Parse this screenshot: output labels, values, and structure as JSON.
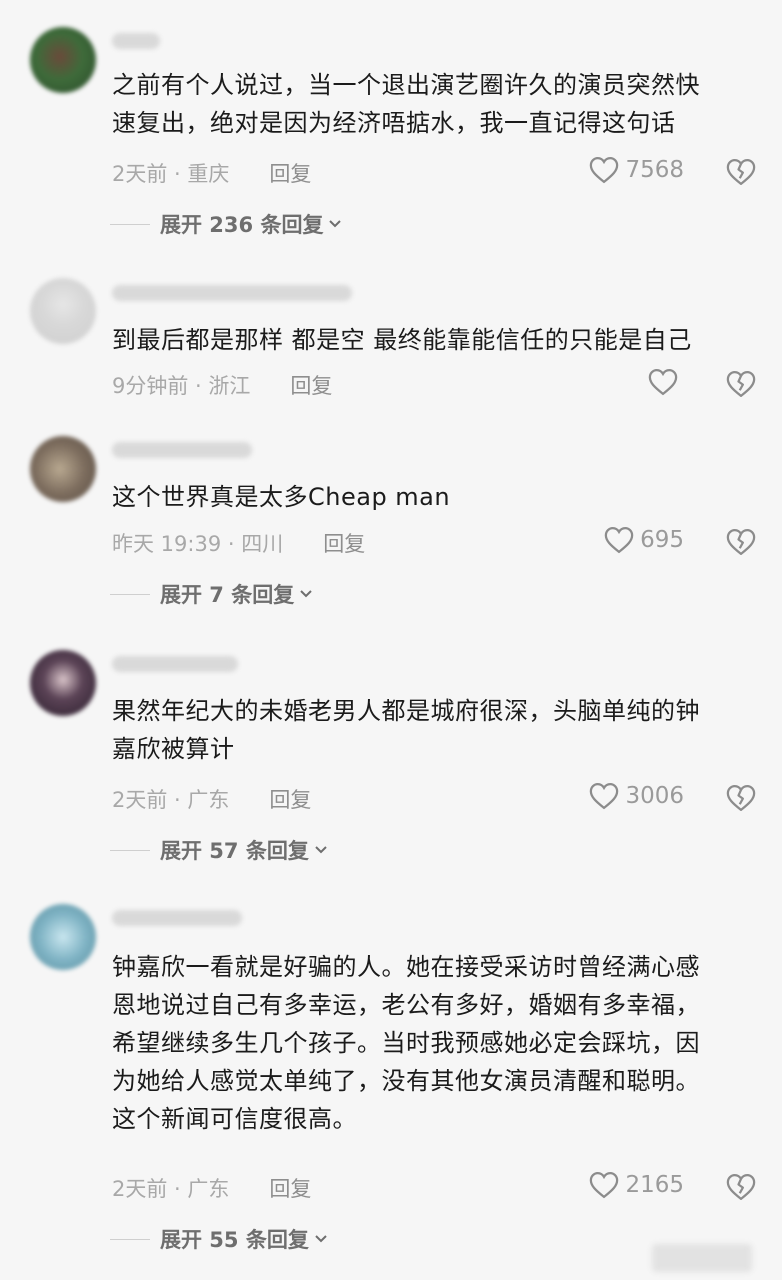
{
  "comments": [
    {
      "text_lines": [
        "之前有个人说过，当一个退出演艺圈许久的演员突然快",
        "速复出，绝对是因为经济唔掂水，我一直记得这句话"
      ],
      "time": "2天前 · 重庆",
      "reply_label": "回复",
      "likes": "7568",
      "expand_label": "展开 236 条回复"
    },
    {
      "text_lines": [
        "到最后都是那样 都是空 最终能靠能信任的只能是自己"
      ],
      "time": "9分钟前 · 浙江",
      "reply_label": "回复",
      "likes": ""
    },
    {
      "text_lines": [
        "这个世界真是太多Cheap man"
      ],
      "time": "昨天 19:39 · 四川",
      "reply_label": "回复",
      "likes": "695",
      "expand_label": "展开 7 条回复"
    },
    {
      "text_lines": [
        "果然年纪大的未婚老男人都是城府很深，头脑单纯的钟",
        "嘉欣被算计"
      ],
      "time": "2天前 · 广东",
      "reply_label": "回复",
      "likes": "3006",
      "expand_label": "展开 57 条回复"
    },
    {
      "text_lines": [
        "钟嘉欣一看就是好骗的人。她在接受采访时曾经满心感",
        "恩地说过自己有多幸运，老公有多好，婚姻有多幸福，",
        "希望继续多生几个孩子。当时我预感她必定会踩坑，因",
        "为她给人感觉太单纯了，没有其他女演员清醒和聪明。",
        "这个新闻可信度很高。"
      ],
      "time": "2天前 · 广东",
      "reply_label": "回复",
      "likes": "2165",
      "expand_label": "展开 55 条回复"
    }
  ]
}
